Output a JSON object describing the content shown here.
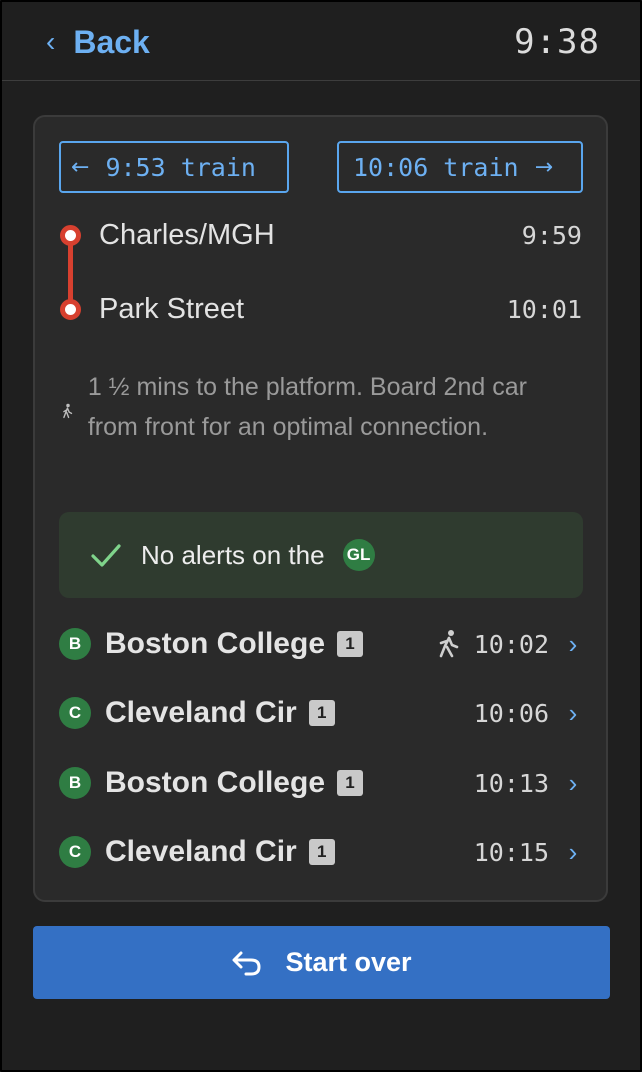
{
  "header": {
    "back_label": "Back",
    "back_icon": "chevron-left-icon",
    "time": "9:38"
  },
  "trains": {
    "prev_label": "9:53 train",
    "prev_icon": "arrow-left-icon",
    "next_label": "10:06 train",
    "next_icon": "arrow-right-icon"
  },
  "route": {
    "line_color": "#d7402f",
    "stops": [
      {
        "name": "Charles/MGH",
        "time": "9:59"
      },
      {
        "name": "Park Street",
        "time": "10:01"
      }
    ]
  },
  "walk_note": {
    "icon": "walking-person-icon",
    "text": "1 ½ mins to the platform. Board 2nd car from front for an optimal connection."
  },
  "alert": {
    "icon": "check-icon",
    "text": "No alerts on the",
    "line_badge": "GL",
    "line_color": "#2f7d43"
  },
  "departures": [
    {
      "branch": "B",
      "destination": "Boston College",
      "cars": "1",
      "walk_icon": true,
      "time": "10:02"
    },
    {
      "branch": "C",
      "destination": "Cleveland Cir",
      "cars": "1",
      "walk_icon": false,
      "time": "10:06"
    },
    {
      "branch": "B",
      "destination": "Boston College",
      "cars": "1",
      "walk_icon": false,
      "time": "10:13"
    },
    {
      "branch": "C",
      "destination": "Cleveland Cir",
      "cars": "1",
      "walk_icon": false,
      "time": "10:15"
    }
  ],
  "footer": {
    "start_over_label": "Start over",
    "start_over_icon": "undo-arrow-icon",
    "accent": "#3470c4"
  }
}
